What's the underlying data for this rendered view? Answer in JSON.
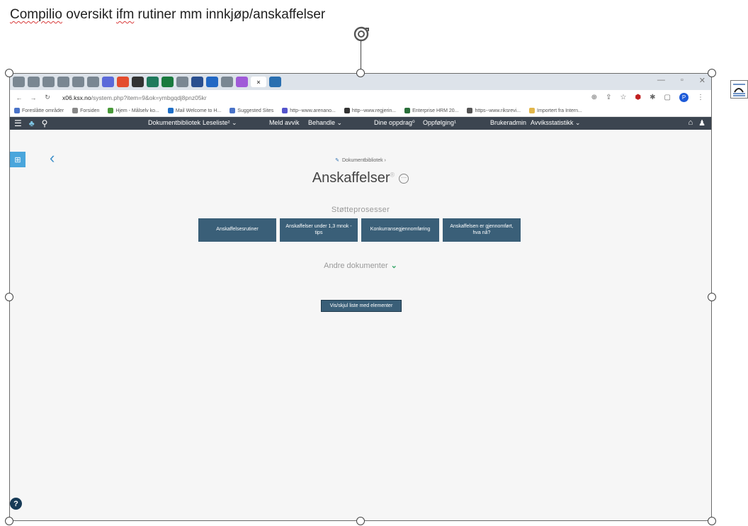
{
  "document": {
    "title_word1": "Compilio",
    "title_mid": " oversikt ",
    "title_word2": "ifm",
    "title_rest": " rutiner mm innkjøp/anskaffelser"
  },
  "browser": {
    "tabs_colors": [
      "#7a8792",
      "#7a8792",
      "#7a8792",
      "#7a8792",
      "#7a8792",
      "#7a8792",
      "#5b6ad9",
      "#e44d2e",
      "#333333",
      "#1f7a5c",
      "#1a7a3e",
      "#7a8792",
      "#2a4f8f",
      "#2268c4",
      "#7a8792",
      "#a05ad8",
      "#2a6fb0"
    ],
    "active_tab_close": "×",
    "window_min": "—",
    "window_max": "▫",
    "window_close": "✕",
    "url_host": "x06.ksx.no",
    "url_path": "/system.php?item=9&ok=ymbgqdj8pnz05kr",
    "bookmarks": [
      {
        "label": "Foreslåtte områder",
        "color": "#4a73c8"
      },
      {
        "label": "Forsiden",
        "color": "#888888"
      },
      {
        "label": "Hjem - Målselv ko...",
        "color": "#4a9a3a"
      },
      {
        "label": "Mail Welcome to H...",
        "color": "#1e6fc8"
      },
      {
        "label": "Suggested Sites",
        "color": "#4a73c8"
      },
      {
        "label": "http--www.arenano...",
        "color": "#5555cc"
      },
      {
        "label": "http--www.regjerin...",
        "color": "#333333"
      },
      {
        "label": "Enterprise HRM 20...",
        "color": "#2a6f3a"
      },
      {
        "label": "https--www.riksrevi...",
        "color": "#555555"
      },
      {
        "label": "Importert fra Intern...",
        "color": "#e2b64a"
      }
    ],
    "profile_initial": "P"
  },
  "app": {
    "nav": {
      "dokumentbibliotek": "Dokumentbibliotek",
      "leseliste": "Leseliste² ⌄",
      "meld_avvik": "Meld avvik",
      "behandle": "Behandle ⌄",
      "dine_oppdrag": "Dine oppdrag⁰",
      "oppfolging": "Oppfølging¹",
      "brukeradmin": "Brukeradmin",
      "avviksstatistikk": "Avviksstatistikk ⌄"
    },
    "breadcrumb": "Dokumentbibliotek ›",
    "page_title": "Anskaffelser",
    "page_title_sup": "®",
    "section_label": "Støtteprosesser",
    "tiles": [
      "Anskaffelsesrutiner",
      "Anskaffelser under 1,3 mnok - tips",
      "Konkurransegjennomføring",
      "Anskaffelsen er gjennomført, hva nå?"
    ],
    "more_docs": "Andre dokumenter",
    "toggle_button": "Vis/skjul liste med elementer",
    "help": "?"
  }
}
